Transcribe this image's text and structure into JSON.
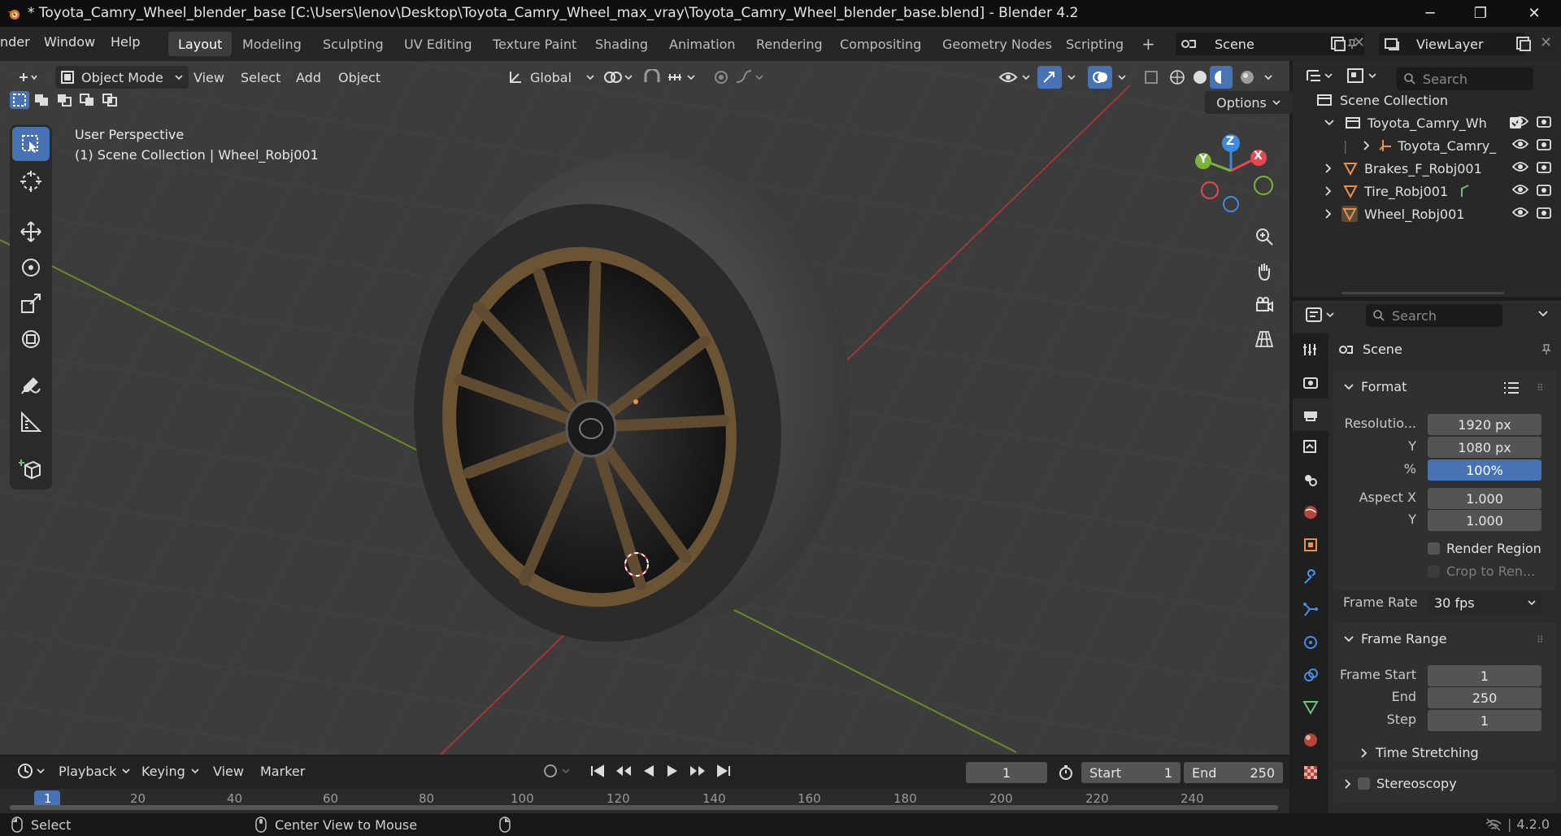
{
  "window": {
    "title": "* Toyota_Camry_Wheel_blender_base [C:\\Users\\lenov\\Desktop\\Toyota_Camry_Wheel_max_vray\\Toyota_Camry_Wheel_blender_base.blend] - Blender 4.2",
    "minimize": "─",
    "maximize": "❐",
    "close": "✕"
  },
  "menu": [
    "nder",
    "Window",
    "Help"
  ],
  "workspaces": [
    "Layout",
    "Modeling",
    "Sculpting",
    "UV Editing",
    "Texture Paint",
    "Shading",
    "Animation",
    "Rendering",
    "Compositing",
    "Geometry Nodes",
    "Scripting"
  ],
  "workspace_add": "+",
  "scene_name": "Scene",
  "view_layer_name": "ViewLayer",
  "viewport": {
    "mode": "Object Mode",
    "menus": [
      "View",
      "Select",
      "Add",
      "Object"
    ],
    "orientation": "Global",
    "options": "Options",
    "overlay_title": "User Perspective",
    "overlay_subtitle": "(1) Scene Collection | Wheel_Robj001",
    "gizmo": {
      "x": "X",
      "y": "Y",
      "z": "Z"
    }
  },
  "outliner": {
    "search_placeholder": "Search",
    "root": "Scene Collection",
    "items": [
      {
        "label": "Toyota_Camry_Wh"
      },
      {
        "label": "Toyota_Camry_"
      },
      {
        "label": "Brakes_F_Robj001"
      },
      {
        "label": "Tire_Robj001"
      },
      {
        "label": "Wheel_Robj001"
      }
    ]
  },
  "properties": {
    "search_placeholder": "Search",
    "context": "Scene",
    "format_panel": "Format",
    "resolution_label": "Resolutio...",
    "resolution_x": "1920 px",
    "y_label": "Y",
    "resolution_y": "1080 px",
    "percent_label": "%",
    "resolution_percent": "100%",
    "aspect_label": "Aspect X",
    "aspect_x": "1.000",
    "aspect_y_label": "Y",
    "aspect_y": "1.000",
    "render_region": "Render Region",
    "crop": "Crop to Ren...",
    "frame_rate_label": "Frame Rate",
    "frame_rate": "30 fps",
    "frame_range_panel": "Frame Range",
    "frame_start_label": "Frame Start",
    "frame_start": "1",
    "end_label": "End",
    "frame_end": "250",
    "step_label": "Step",
    "frame_step": "1",
    "time_stretching": "Time Stretching",
    "stereoscopy": "Stereoscopy"
  },
  "timeline": {
    "menus": [
      "Playback",
      "Keying",
      "View",
      "Marker"
    ],
    "current_frame": "1",
    "start_label": "Start",
    "start": "1",
    "end_label": "End",
    "end": "250",
    "ticks": [
      "1",
      "20",
      "40",
      "60",
      "80",
      "100",
      "120",
      "140",
      "160",
      "180",
      "200",
      "220",
      "240"
    ]
  },
  "status": {
    "select": "Select",
    "center_view": "Center View to Mouse",
    "version": "4.2.0"
  },
  "colors": {
    "accent": "#4772b3",
    "axis_x": "#a03838",
    "axis_y": "#6a8a2a",
    "gizmo_x": "#e5484d",
    "gizmo_y": "#7cb33a",
    "gizmo_z": "#3d8be0",
    "object_orange": "#e8914a"
  }
}
